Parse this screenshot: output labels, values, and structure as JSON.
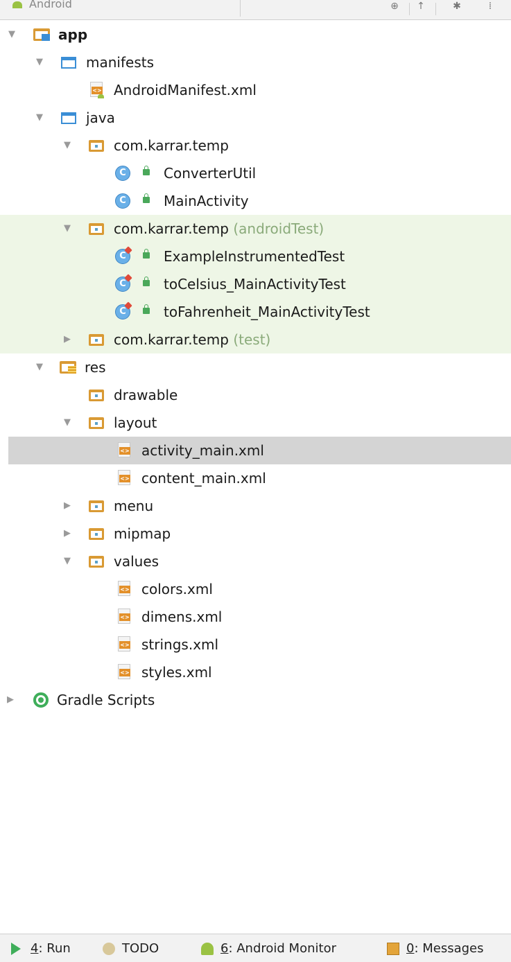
{
  "toolbar": {
    "view_label": "Android"
  },
  "tree": {
    "app": "app",
    "manifests": "manifests",
    "android_manifest": "AndroidManifest.xml",
    "java": "java",
    "pkg_main": "com.karrar.temp",
    "converter_util": "ConverterUtil",
    "main_activity": "MainActivity",
    "pkg_android_test": "com.karrar.temp",
    "android_test_suffix": "(androidTest)",
    "example_instrumented_test": "ExampleInstrumentedTest",
    "to_celsius_test": "toCelsius_MainActivityTest",
    "to_fahrenheit_test": "toFahrenheit_MainActivityTest",
    "pkg_test": "com.karrar.temp",
    "test_suffix": "(test)",
    "res": "res",
    "drawable": "drawable",
    "layout": "layout",
    "activity_main": "activity_main.xml",
    "content_main": "content_main.xml",
    "menu": "menu",
    "mipmap": "mipmap",
    "values": "values",
    "colors": "colors.xml",
    "dimens": "dimens.xml",
    "strings": "strings.xml",
    "styles": "styles.xml",
    "gradle_scripts": "Gradle Scripts",
    "class_letter": "C"
  },
  "bottom_bar": {
    "run_key": "4",
    "run_label": ": Run",
    "todo_label": "TODO",
    "monitor_key": "6",
    "monitor_label": ": Android Monitor",
    "messages_key": "0",
    "messages_label": ": Messages"
  },
  "colors": {
    "selected_row": "#d4d4d4",
    "test_rows": "#eef6e6",
    "test_suffix": "#8aaa7a"
  }
}
